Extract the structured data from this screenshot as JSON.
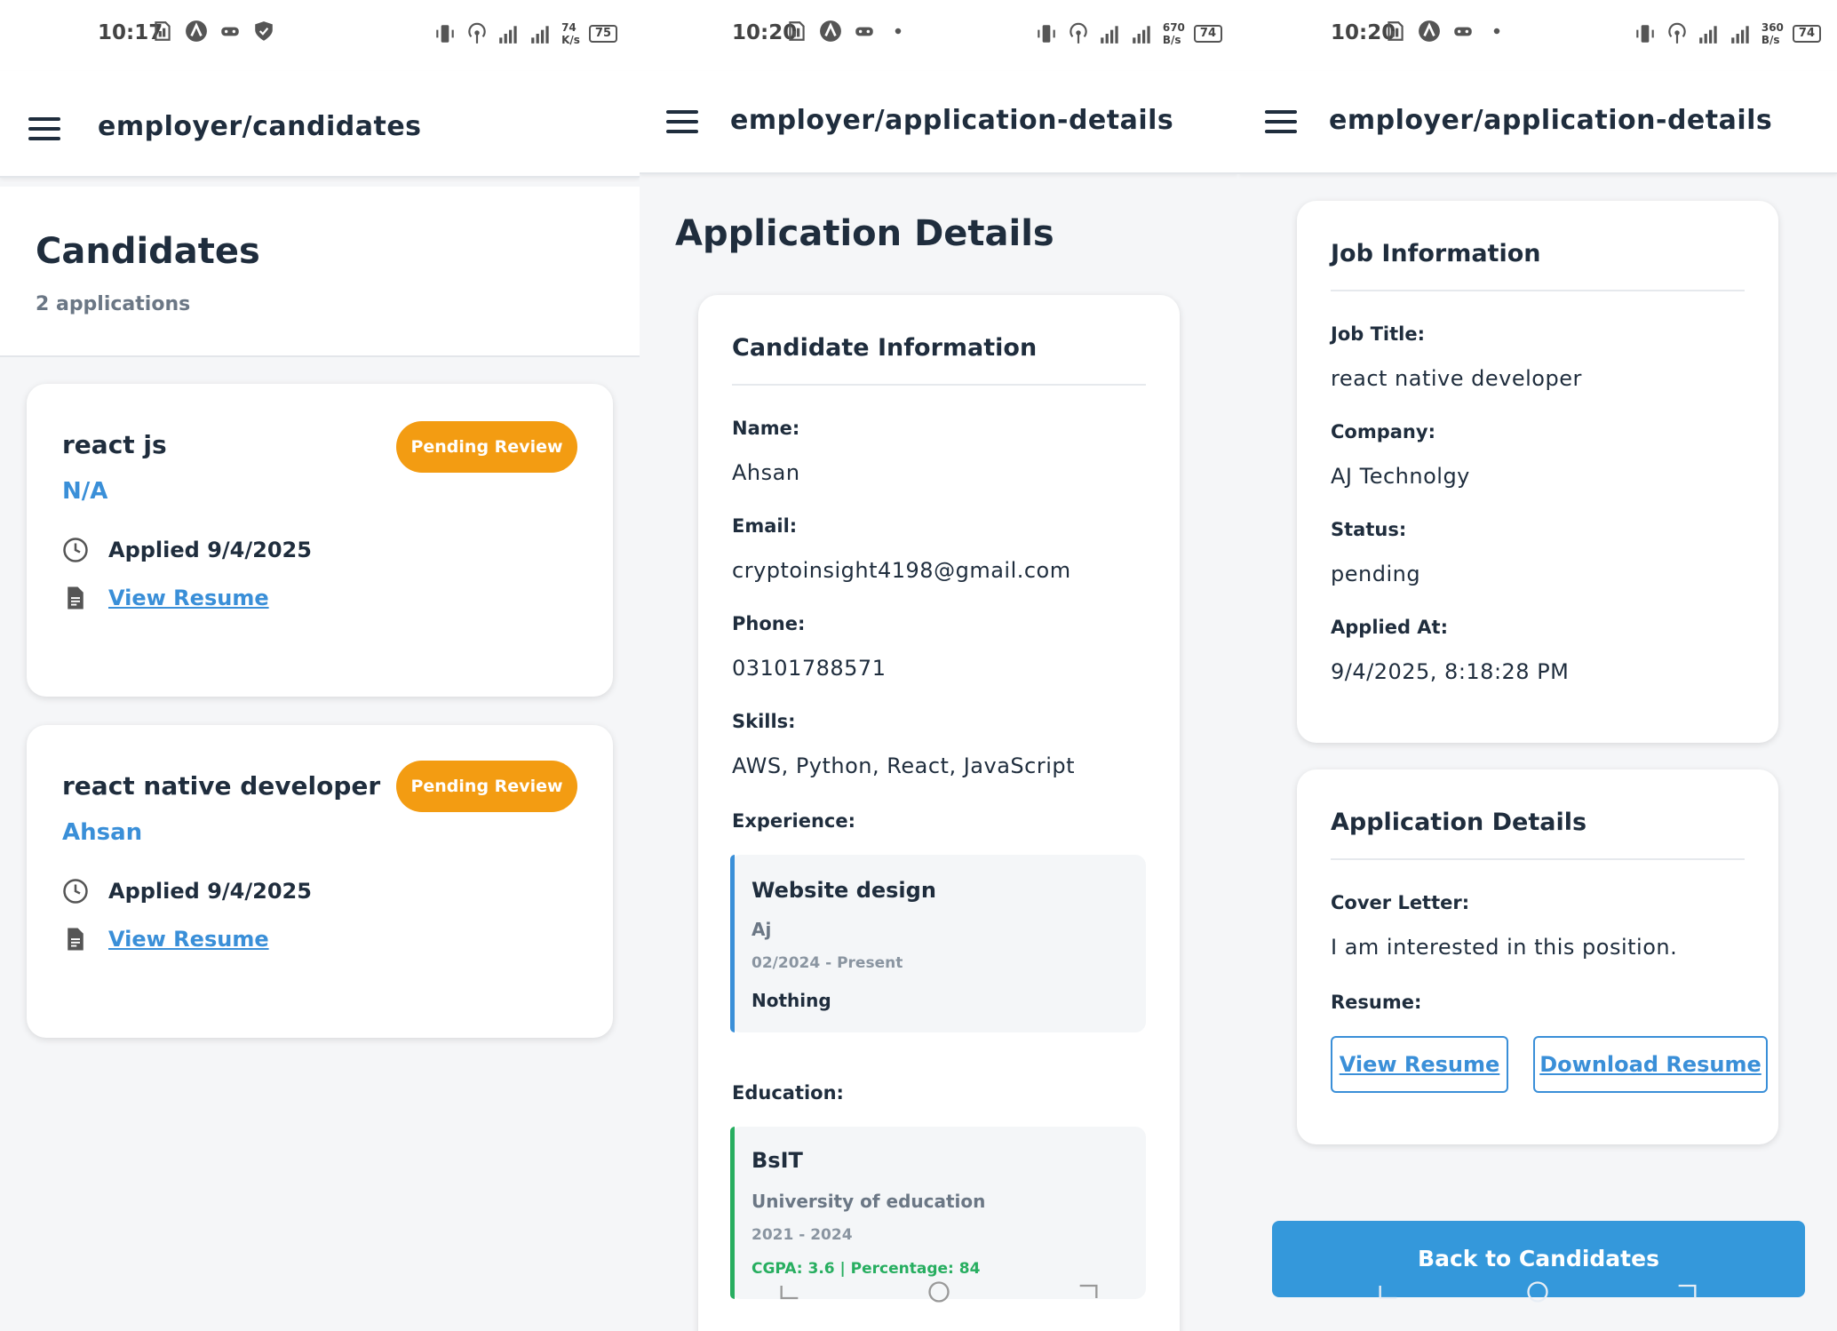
{
  "screen1": {
    "status": {
      "time": "10:17",
      "net": "74\nK/s",
      "battery": "75"
    },
    "route": "employer/candidates",
    "title": "Candidates",
    "count": "2 applications",
    "cards": [
      {
        "job": "react js",
        "candidate": "N/A",
        "badge": "Pending Review",
        "applied": "Applied 9/4/2025",
        "resume": "View Resume"
      },
      {
        "job": "react native developer",
        "candidate": "Ahsan",
        "badge": "Pending Review",
        "applied": "Applied 9/4/2025",
        "resume": "View Resume"
      }
    ]
  },
  "screen2": {
    "status": {
      "time": "10:20",
      "net": "670\nB/s",
      "battery": "74"
    },
    "route": "employer/application-details",
    "title": "Application Details",
    "section": "Candidate Information",
    "fields": {
      "name_label": "Name:",
      "name": "Ahsan",
      "email_label": "Email:",
      "email": "cryptoinsight4198@gmail.com",
      "phone_label": "Phone:",
      "phone": "03101788571",
      "skills_label": "Skills:",
      "skills": "AWS, Python, React, JavaScript",
      "experience_label": "Experience:",
      "education_label": "Education:"
    },
    "experience": {
      "title": "Website design",
      "company": "Aj",
      "dates": "02/2024 - Present",
      "desc": "Nothing"
    },
    "education": {
      "degree": "BsIT",
      "school": "University of education",
      "years": "2021 - 2024",
      "score": "CGPA: 3.6 | Percentage: 84"
    }
  },
  "screen3": {
    "status": {
      "time": "10:20",
      "net": "360\nB/s",
      "battery": "74"
    },
    "route": "employer/application-details",
    "job_section": "Job Information",
    "job": {
      "title_label": "Job Title:",
      "title": "react native developer",
      "company_label": "Company:",
      "company": "AJ Technolgy",
      "status_label": "Status:",
      "status": "pending",
      "applied_label": "Applied At:",
      "applied": "9/4/2025, 8:18:28 PM"
    },
    "app_section": "Application Details",
    "app": {
      "cover_label": "Cover Letter:",
      "cover": "I am interested in this position.",
      "resume_label": "Resume:",
      "view": "View Resume",
      "download": "Download Resume"
    },
    "back": "Back to Candidates"
  },
  "colors": {
    "accent": "#3a8fd8",
    "badge": "#f39c12",
    "education_accent": "#27ae60",
    "primary": "#3498db",
    "text": "#1f2d3d"
  },
  "icons": [
    "menu-icon",
    "clock-icon",
    "document-icon",
    "sim-icon",
    "app-icon",
    "game-icon",
    "shield-icon",
    "vibrate-icon",
    "hotspot-icon",
    "signal-icon",
    "battery-icon"
  ]
}
